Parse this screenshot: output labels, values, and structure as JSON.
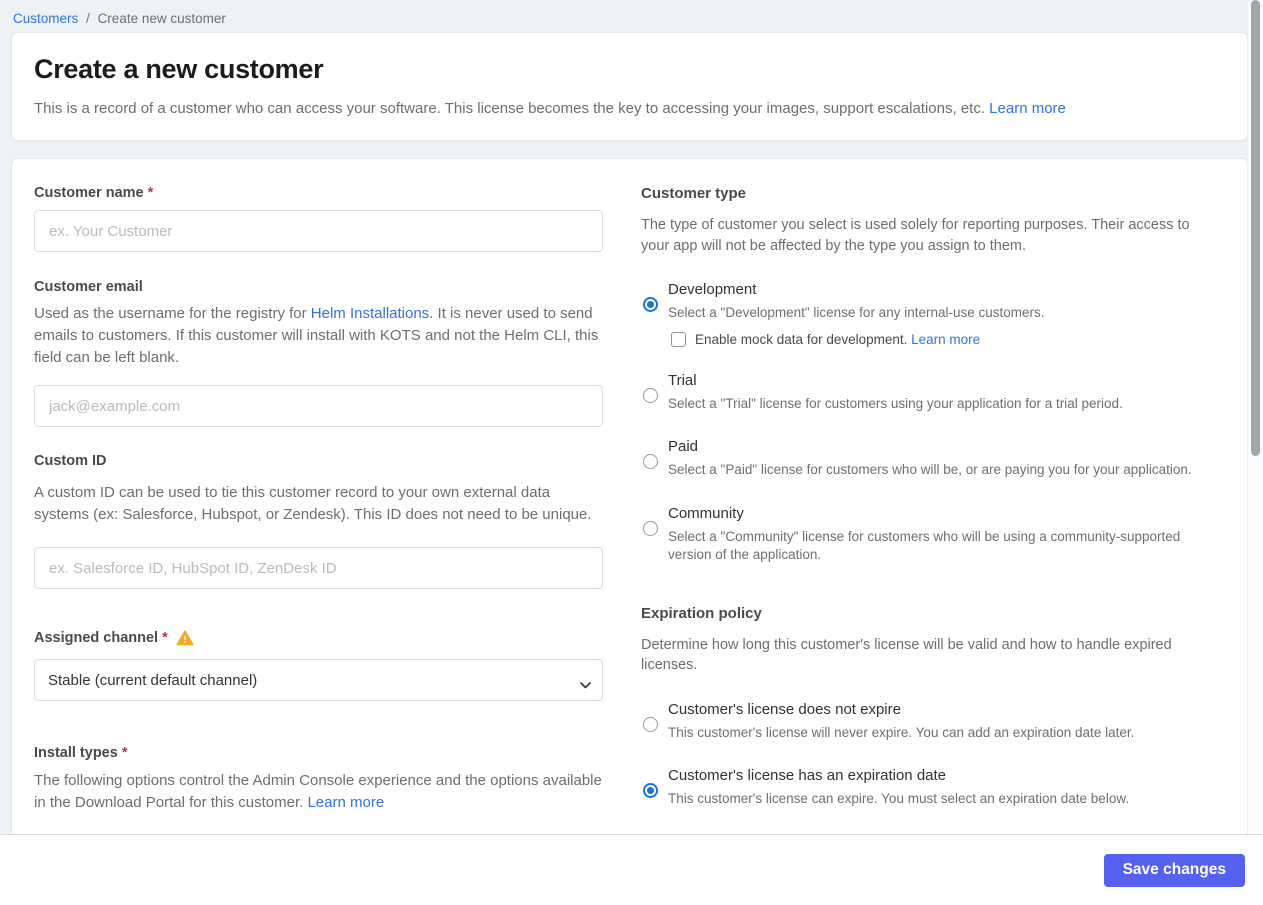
{
  "colors": {
    "page_bg": "#EEF2F5",
    "card_bg": "#FFFFFF",
    "card_border": "#E4E8EB",
    "accent": "#5661F0",
    "link": "#3273DC",
    "radio_selected": "#1876D2",
    "warning": "#F7A823",
    "required_red": "#B13A41",
    "heading_text": "#1C1C1E",
    "label_text": "#4A4A4A",
    "body_text": "#6E6E6E",
    "title_text": "#323232",
    "placeholder": "#B6BCBF",
    "input_border": "#DFDFDF",
    "footer_border": "#D8DCDD",
    "scroll_thumb": "#A3A7AB"
  },
  "breadcrumb": {
    "parent": "Customers",
    "separator": "/",
    "current": "Create new customer"
  },
  "header": {
    "title": "Create a new customer",
    "description": "This is a record of a customer who can access your software. This license becomes the key to accessing your images, support escalations, etc.",
    "learn_more": "Learn more"
  },
  "form": {
    "customer_name": {
      "label": "Customer name",
      "required": "*",
      "placeholder": "ex. Your Customer",
      "value": ""
    },
    "customer_email": {
      "label": "Customer email",
      "help_before_link": "Used as the username for the registry for ",
      "help_link": "Helm Installations",
      "help_after_link": ". It is never used to send emails to customers. If this customer will install with KOTS and not the Helm CLI, this field can be left blank.",
      "placeholder": "jack@example.com",
      "value": ""
    },
    "custom_id": {
      "label": "Custom ID",
      "help": "A custom ID can be used to tie this customer record to your own external data systems (ex: Salesforce, Hubspot, or Zendesk). This ID does not need to be unique.",
      "placeholder": "ex. Salesforce ID, HubSpot ID, ZenDesk ID",
      "value": ""
    },
    "assigned_channel": {
      "label": "Assigned channel",
      "required": "*",
      "warning_icon": "warning-triangle-icon",
      "selected_option": "Stable (current default channel)"
    },
    "install_types": {
      "label": "Install types",
      "required": "*",
      "help": "The following options control the Admin Console experience and the options available in the Download Portal for this customer.",
      "learn_more": "Learn more"
    },
    "customer_type": {
      "heading": "Customer type",
      "description": "The type of customer you select is used solely for reporting purposes. Their access to your app will not be affected by the type you assign to them.",
      "options": [
        {
          "title": "Development",
          "description": "Select a \"Development\" license for any internal-use customers.",
          "selected": true,
          "checkbox": {
            "label": "Enable mock data for development.",
            "link": "Learn more",
            "checked": false
          }
        },
        {
          "title": "Trial",
          "description": "Select a \"Trial\" license for customers using your application for a trial period.",
          "selected": false
        },
        {
          "title": "Paid",
          "description": "Select a \"Paid\" license for customers who will be, or are paying you for your application.",
          "selected": false
        },
        {
          "title": "Community",
          "description": "Select a \"Community\" license for customers who will be using a community-supported version of the application.",
          "selected": false
        }
      ]
    },
    "expiration_policy": {
      "heading": "Expiration policy",
      "description": "Determine how long this customer's license will be valid and how to handle expired licenses.",
      "options": [
        {
          "title": "Customer's license does not expire",
          "description": "This customer's license will never expire. You can add an expiration date later.",
          "selected": false
        },
        {
          "title": "Customer's license has an expiration date",
          "description": "This customer's license can expire. You must select an expiration date below.",
          "selected": true
        }
      ]
    }
  },
  "footer": {
    "save_label": "Save changes"
  }
}
